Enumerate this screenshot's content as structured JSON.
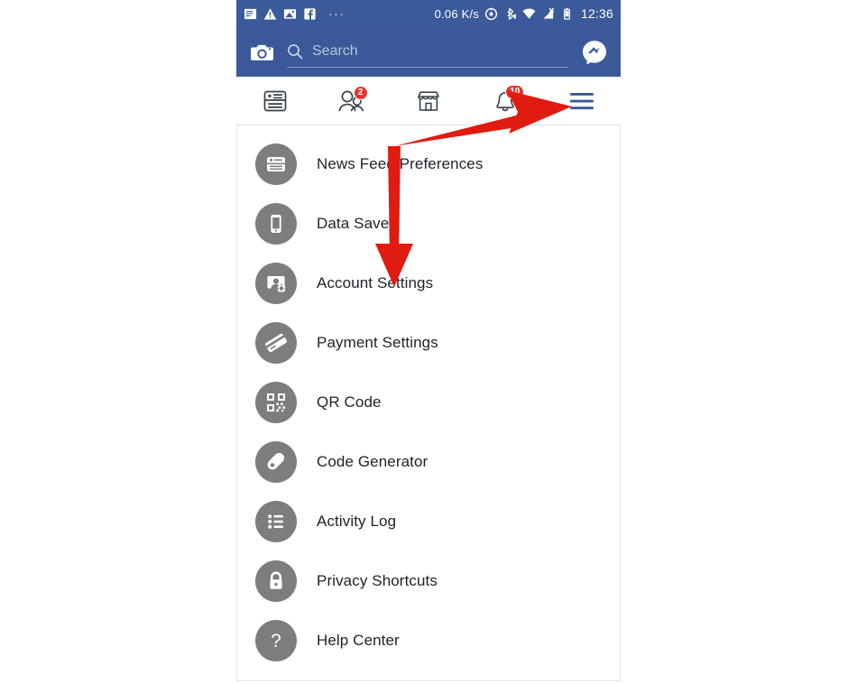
{
  "status_bar": {
    "icons": [
      "document-icon",
      "warning-triangle-icon",
      "image-icon",
      "facebook-icon"
    ],
    "overflow": "···",
    "network_speed": "0.06 K/s",
    "right_icons": [
      "location-icon",
      "bluetooth-icon",
      "wifi-icon",
      "signal-off-icon",
      "battery-icon"
    ],
    "time": "12:36"
  },
  "header": {
    "camera_icon": "camera-icon",
    "search_placeholder": "Search",
    "search_value": "",
    "messenger_icon": "messenger-icon",
    "background_color": "#3b5998"
  },
  "tabs": [
    {
      "name": "news-feed",
      "icon": "news-feed-icon",
      "badge": "",
      "active": false
    },
    {
      "name": "friends",
      "icon": "friends-icon",
      "badge": "2",
      "active": false
    },
    {
      "name": "marketplace",
      "icon": "marketplace-icon",
      "badge": "",
      "active": false
    },
    {
      "name": "notifications",
      "icon": "notifications-icon",
      "badge": "10",
      "active": false
    },
    {
      "name": "menu",
      "icon": "hamburger-menu-icon",
      "badge": "",
      "active": true
    }
  ],
  "menu": {
    "items": [
      {
        "label": "News Feed Preferences",
        "icon": "news-feed-preferences-icon"
      },
      {
        "label": "Data Saver",
        "icon": "data-saver-icon"
      },
      {
        "label": "Account Settings",
        "icon": "account-settings-icon"
      },
      {
        "label": "Payment Settings",
        "icon": "payment-settings-icon"
      },
      {
        "label": "QR Code",
        "icon": "qr-code-icon"
      },
      {
        "label": "Code Generator",
        "icon": "code-generator-icon"
      },
      {
        "label": "Activity Log",
        "icon": "activity-log-icon"
      },
      {
        "label": "Privacy Shortcuts",
        "icon": "privacy-shortcuts-icon"
      },
      {
        "label": "Help Center",
        "icon": "help-center-icon"
      }
    ]
  },
  "annotation": {
    "arrow_color": "#e01b10",
    "description": "bent-arrow-pointing-to-menu-and-account-settings"
  },
  "colors": {
    "facebook_blue": "#3b5998",
    "status_bar_blue": "#3b5a9a",
    "badge_red": "#e8352b",
    "icon_gray": "#7d7d7d",
    "text_dark": "#1d2129"
  }
}
